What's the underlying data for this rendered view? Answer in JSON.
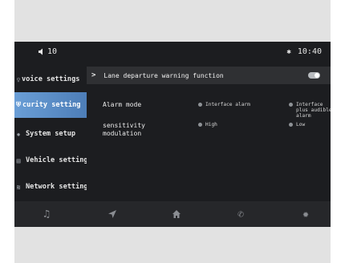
{
  "status": {
    "volume_level": "10",
    "time": "10:40",
    "bluetooth_icon": "bluetooth-icon",
    "volume_icon": "volume-icon"
  },
  "sidebar": {
    "items": [
      {
        "label": "voice settings",
        "icon": "voice-icon",
        "active": false
      },
      {
        "label": "curity setting",
        "icon": "shield-icon",
        "active": true
      },
      {
        "label": "System setup",
        "icon": "gear-icon",
        "active": false
      },
      {
        "label": "Vehicle setting",
        "icon": "car-icon",
        "active": false
      },
      {
        "label": "Network settings",
        "icon": "wifi-icon",
        "active": false
      }
    ]
  },
  "content": {
    "header": {
      "chevron": ">",
      "label": "Lane departure warning function",
      "toggle_on": true
    },
    "alarm_mode": {
      "label": "Alarm mode",
      "options": [
        "Interface alarm",
        "Interface plus audible alarm"
      ]
    },
    "sensitivity": {
      "label": "sensitivity modulation",
      "options": [
        "High",
        "Low"
      ]
    }
  },
  "dock": [
    "music-icon",
    "navigation-icon",
    "home-icon",
    "phone-icon",
    "settings-icon"
  ],
  "colors": {
    "accent": "#5b8dc9",
    "screen_bg": "#1c1d20",
    "frame": "#e2e2e2"
  }
}
